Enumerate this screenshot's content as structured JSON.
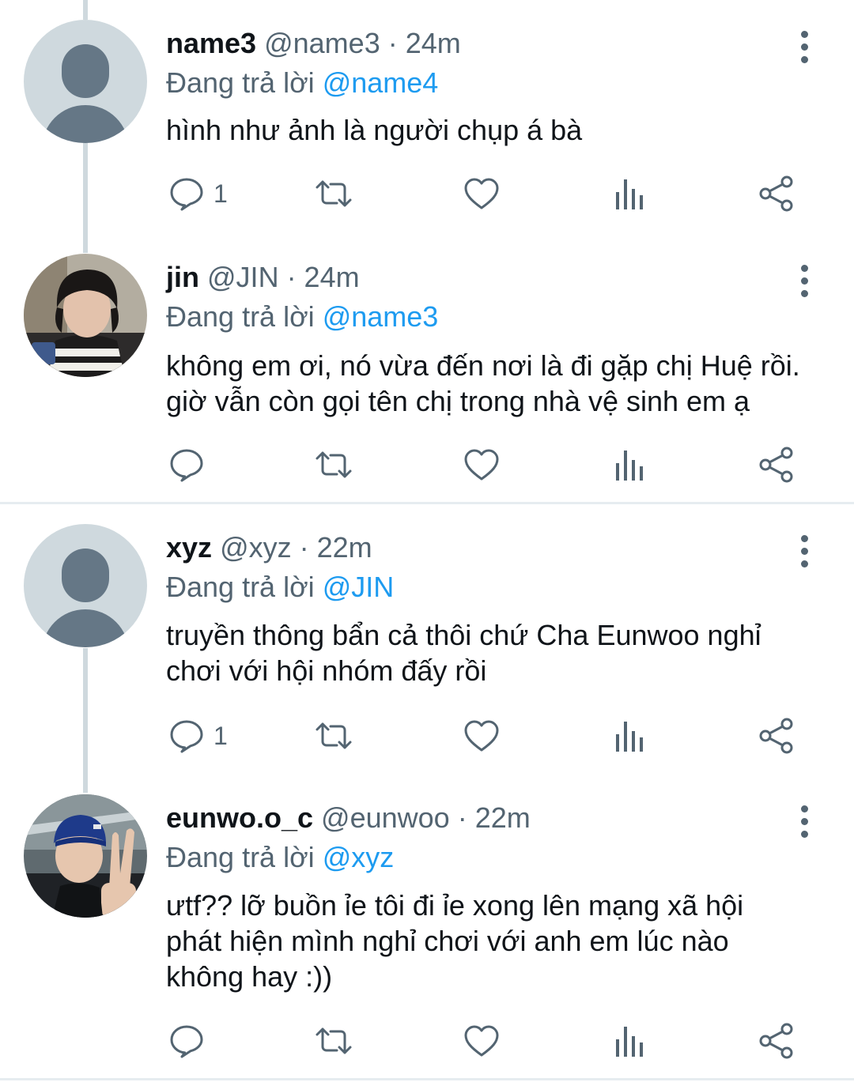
{
  "tweets": [
    {
      "display_name": "name3",
      "meta": "@name3 · 24m",
      "replying_prefix": "Đang trả lời",
      "replying_to": "@name4",
      "lines": [
        "hình như ảnh là người chụp á bà"
      ],
      "reply_count": "1"
    },
    {
      "display_name": "jin",
      "meta": "@JIN · 24m",
      "replying_prefix": "Đang trả lời",
      "replying_to": "@name3",
      "lines": [
        "không em ơi, nó vừa đến nơi là đi gặp chị Huệ rồi.",
        "giờ vẫn còn gọi tên chị trong nhà vệ sinh em ạ"
      ],
      "reply_count": ""
    },
    {
      "display_name": "xyz",
      "meta": "@xyz · 22m",
      "replying_prefix": "Đang trả lời",
      "replying_to": "@JIN",
      "lines": [
        "truyền thông bẩn cả thôi chứ Cha Eunwoo nghỉ",
        "chơi với hội nhóm đấy rồi"
      ],
      "reply_count": "1"
    },
    {
      "display_name": "eunwo.o_c",
      "meta": "@eunwoo · 22m",
      "replying_prefix": "Đang trả lời",
      "replying_to": "@xyz",
      "lines": [
        "ưtf?? lỡ buồn ỉe tôi đi ỉe xong lên mạng xã hội",
        "phát hiện mình nghỉ chơi với anh em lúc nào",
        "không hay :))"
      ],
      "reply_count": ""
    }
  ],
  "icons": {
    "reply": "reply-icon",
    "retweet": "retweet-icon",
    "like": "heart-icon",
    "views": "views-icon",
    "share": "share-icon",
    "more": "more-options-icon"
  },
  "colors": {
    "mention": "#1d9bf0",
    "secondary_text": "#536471",
    "thread_line": "#cfd9de",
    "default_avatar_bg": "#cfd9de",
    "default_avatar_fg": "#657786"
  }
}
